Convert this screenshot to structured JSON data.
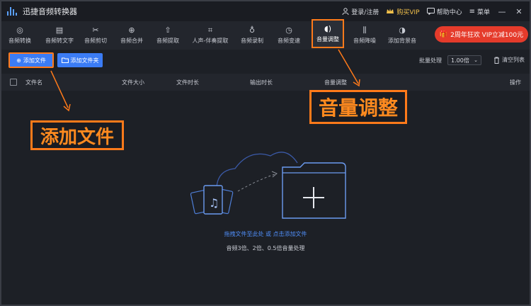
{
  "app": {
    "title": "迅捷音频转换器"
  },
  "titlebar": {
    "login": "登录/注册",
    "buy_vip": "购买VIP",
    "help": "帮助中心",
    "menu": "菜单",
    "minimize": "—",
    "close": "✕"
  },
  "toolbar": {
    "items": [
      {
        "label": "音频转换",
        "icon": "audio-convert-icon"
      },
      {
        "label": "音频转文字",
        "icon": "audio-to-text-icon"
      },
      {
        "label": "音频剪切",
        "icon": "scissors-icon"
      },
      {
        "label": "音频合并",
        "icon": "merge-icon"
      },
      {
        "label": "音频提取",
        "icon": "extract-icon"
      },
      {
        "label": "人声-伴奏提取",
        "icon": "vocal-extract-icon"
      },
      {
        "label": "音频录制",
        "icon": "microphone-icon"
      },
      {
        "label": "音频变速",
        "icon": "speed-icon"
      },
      {
        "label": "音量调整",
        "icon": "volume-icon",
        "active": true
      },
      {
        "label": "音频降噪",
        "icon": "denoise-icon"
      },
      {
        "label": "添加背景音",
        "icon": "background-music-icon"
      }
    ],
    "promo": "2周年狂欢 VIP立减100元"
  },
  "actions": {
    "add_file": "添加文件",
    "add_folder": "添加文件夹",
    "batch_label": "批量处理",
    "batch_value": "1.00倍",
    "clear_list": "清空列表"
  },
  "table": {
    "headers": [
      "文件名",
      "文件大小",
      "文件时长",
      "输出时长",
      "音量调整",
      "操作"
    ]
  },
  "empty": {
    "hint": "拖拽文件至此处 或 点击添加文件",
    "sub": "音频3倍、2倍、0.5倍音量处理"
  },
  "callouts": {
    "add_file": "添加文件",
    "volume": "音量调整"
  },
  "colors": {
    "accent_orange": "#ff7a1a",
    "primary_blue": "#3b7cf5",
    "promo_red": "#e53b2b",
    "background": "#1d2026"
  }
}
